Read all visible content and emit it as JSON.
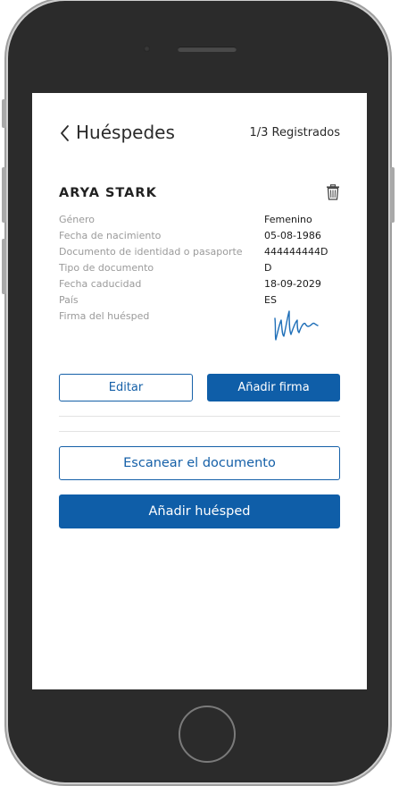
{
  "header": {
    "back_icon": "chevron-left-icon",
    "title": "Huéspedes",
    "count": "1/3 Registrados"
  },
  "guest": {
    "name": "ARYA STARK",
    "delete_icon": "trash-icon",
    "fields": [
      {
        "label": "Género",
        "value": "Femenino"
      },
      {
        "label": "Fecha de nacimiento",
        "value": "05-08-1986"
      },
      {
        "label": "Documento de identidad o pasaporte",
        "value": "444444444D"
      },
      {
        "label": "Tipo de documento",
        "value": "D"
      },
      {
        "label": "Fecha caducidad",
        "value": "18-09-2029"
      },
      {
        "label": "País",
        "value": "ES"
      },
      {
        "label": "Firma del huésped",
        "value": ""
      }
    ]
  },
  "actions": {
    "edit_label": "Editar",
    "add_signature_label": "Añadir firma",
    "scan_label": "Escanear el documento",
    "add_guest_label": "Añadir huésped"
  },
  "colors": {
    "accent": "#0f5ea8",
    "phone_body": "#2b2b2b",
    "label_gray": "#9a9a9a",
    "signature_ink": "#1f6fb8"
  }
}
